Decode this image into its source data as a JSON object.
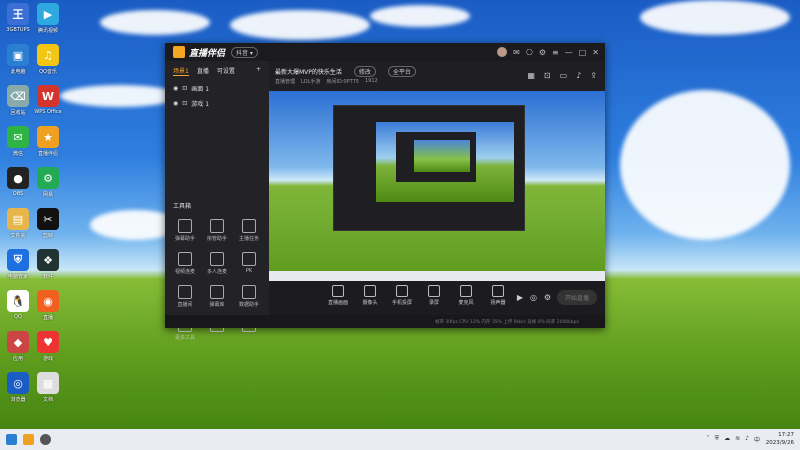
{
  "desktop": {
    "icons": [
      {
        "label": "3GBTUPS",
        "color": "#3b6fd6",
        "glyph": "王"
      },
      {
        "label": "腾讯视频",
        "color": "#2fa8e0",
        "glyph": "▶"
      },
      {
        "label": "此电脑",
        "color": "#2a7fd0",
        "glyph": "▣"
      },
      {
        "label": "QQ音乐",
        "color": "#f2c611",
        "glyph": "♫"
      },
      {
        "label": "回收站",
        "color": "#8aa",
        "glyph": "⌫"
      },
      {
        "label": "WPS Office",
        "color": "#d3342c",
        "glyph": "W"
      },
      {
        "label": "微信",
        "color": "#2fb344",
        "glyph": "✉"
      },
      {
        "label": "直播伴侣",
        "color": "#f0a020",
        "glyph": "★"
      },
      {
        "label": "OBS",
        "color": "#222",
        "glyph": "●"
      },
      {
        "label": "网易",
        "color": "#2a5",
        "glyph": "⚙"
      },
      {
        "label": "文件夹",
        "color": "#e6b64a",
        "glyph": "▤"
      },
      {
        "label": "剪映",
        "color": "#111",
        "glyph": "✂"
      },
      {
        "label": "电脑管家",
        "color": "#1e6fe0",
        "glyph": "⛨"
      },
      {
        "label": "软件",
        "color": "#233",
        "glyph": "❖"
      },
      {
        "label": "QQ",
        "color": "#fff",
        "glyph": "🐧"
      },
      {
        "label": "直播",
        "color": "#f06020",
        "glyph": "◉"
      },
      {
        "label": "应用",
        "color": "#c44",
        "glyph": "◆"
      },
      {
        "label": "游戏",
        "color": "#e33",
        "glyph": "♥"
      },
      {
        "label": "浏览器",
        "color": "#1a5cc4",
        "glyph": "◎"
      },
      {
        "label": "文档",
        "color": "#ddd",
        "glyph": "▦"
      }
    ]
  },
  "app": {
    "name": "直播伴侣",
    "badge": "抖音 ▾",
    "left_tabs": [
      "场景1",
      "直播",
      "可设置"
    ],
    "scenes": [
      "画面 1",
      "游戏 1"
    ],
    "toolbox_title": "工具箱",
    "tools": [
      "弹幕助手",
      "房管助手",
      "主播任务",
      "视频连麦",
      "多人连麦",
      "PK",
      "直播间",
      "弹幕库",
      "数据助手",
      "更多工具",
      "",
      ""
    ],
    "stream_title": "最新大爆MVP的快乐生活",
    "stream_tag": "修改",
    "stream_tag2": "全平台",
    "sub_info": [
      "直播管理",
      "LOL手游",
      "房间ID:0PT75",
      "1912"
    ],
    "bottom_tools": [
      "直播画面",
      "摄像头",
      "手机投屏",
      "录屏",
      "麦克风",
      "扬声器"
    ],
    "start_button": "开始直播",
    "status_text": "帧率 30fps   CPU 12%   内存 35%   上传 0kb/s   丢帧 0%   码率 2000kbps"
  },
  "taskbar": {
    "time": "17:27",
    "date": "2023/9/26"
  }
}
